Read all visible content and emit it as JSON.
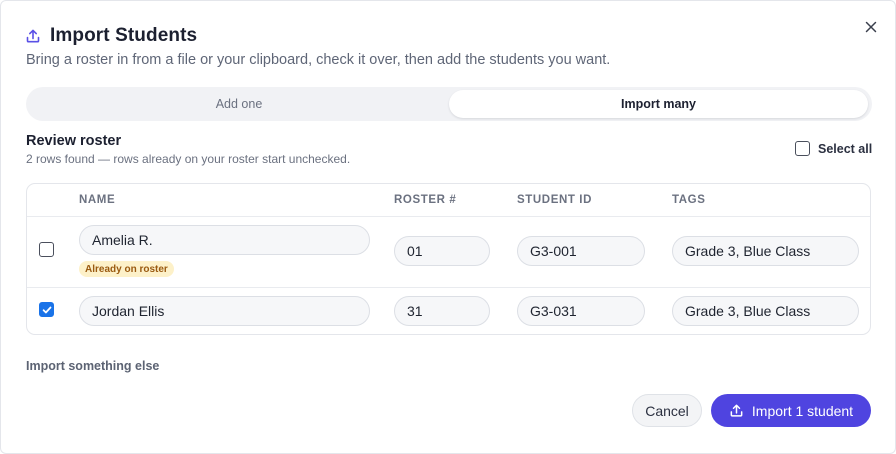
{
  "dialog": {
    "title": "Import Students",
    "subtitle": "Bring a roster in from a file or your clipboard, check it over, then add the students you want.",
    "icon": "upload-icon",
    "close_icon": "close-icon"
  },
  "tabs": {
    "items": [
      {
        "label": "Add one",
        "active": false
      },
      {
        "label": "Import many",
        "active": true
      }
    ]
  },
  "review": {
    "title": "Review roster",
    "description": "2 rows found — rows already on your roster start unchecked.",
    "select_all_label": "Select all",
    "select_all_checked": false
  },
  "table": {
    "columns": [
      "NAME",
      "ROSTER #",
      "STUDENT ID",
      "TAGS"
    ],
    "rows": [
      {
        "checked": false,
        "name": "Amelia R.",
        "badge": "Already on roster",
        "roster": "01",
        "student_id": "G3-001",
        "tags": "Grade 3, Blue Class"
      },
      {
        "checked": true,
        "name": "Jordan Ellis",
        "badge": "",
        "roster": "31",
        "student_id": "G3-031",
        "tags": "Grade 3, Blue Class"
      }
    ]
  },
  "footer": {
    "import_else": "Import something else",
    "cancel_label": "Cancel",
    "primary_label": "Import 1 student",
    "primary_icon": "upload-icon"
  },
  "colors": {
    "accent": "#4f44e0",
    "checkbox_checked": "#1a73e8",
    "badge_bg": "#fdf1c9",
    "badge_text": "#9a5a10"
  }
}
